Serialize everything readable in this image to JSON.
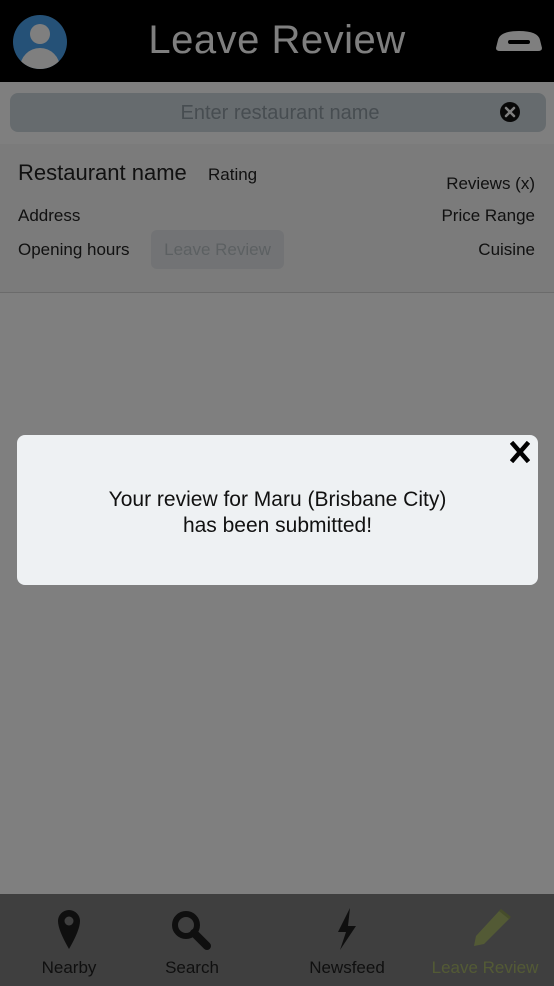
{
  "header": {
    "title": "Leave Review",
    "avatar_icon": "user-avatar-icon",
    "right_icon": "chef-hat-icon"
  },
  "search": {
    "placeholder": "Enter restaurant name",
    "clear_icon": "clear-circle-icon"
  },
  "restaurant_card": {
    "name": "Restaurant name",
    "rating": "Rating",
    "reviews": "Reviews (x)",
    "address": "Address",
    "price_range": "Price Range",
    "opening_hours": "Opening hours",
    "cuisine": "Cuisine",
    "leave_review_button": "Leave Review"
  },
  "modal": {
    "line1": "Your review for Maru (Brisbane City)",
    "line2": "has been submitted!",
    "close_icon": "close-x-icon"
  },
  "tabs": [
    {
      "label": "Nearby",
      "icon": "map-pin-icon",
      "active": false
    },
    {
      "label": "Search",
      "icon": "magnifier-icon",
      "active": false
    },
    {
      "label": "Newsfeed",
      "icon": "lightning-icon",
      "active": false
    },
    {
      "label": "Leave Review",
      "icon": "pencil-icon",
      "active": true
    }
  ],
  "colors": {
    "header_bg": "#000000",
    "avatar_blue": "#4aa3ef",
    "active_tab": "#a7b56b",
    "overlay": "rgba(0,0,0,0.5)"
  }
}
